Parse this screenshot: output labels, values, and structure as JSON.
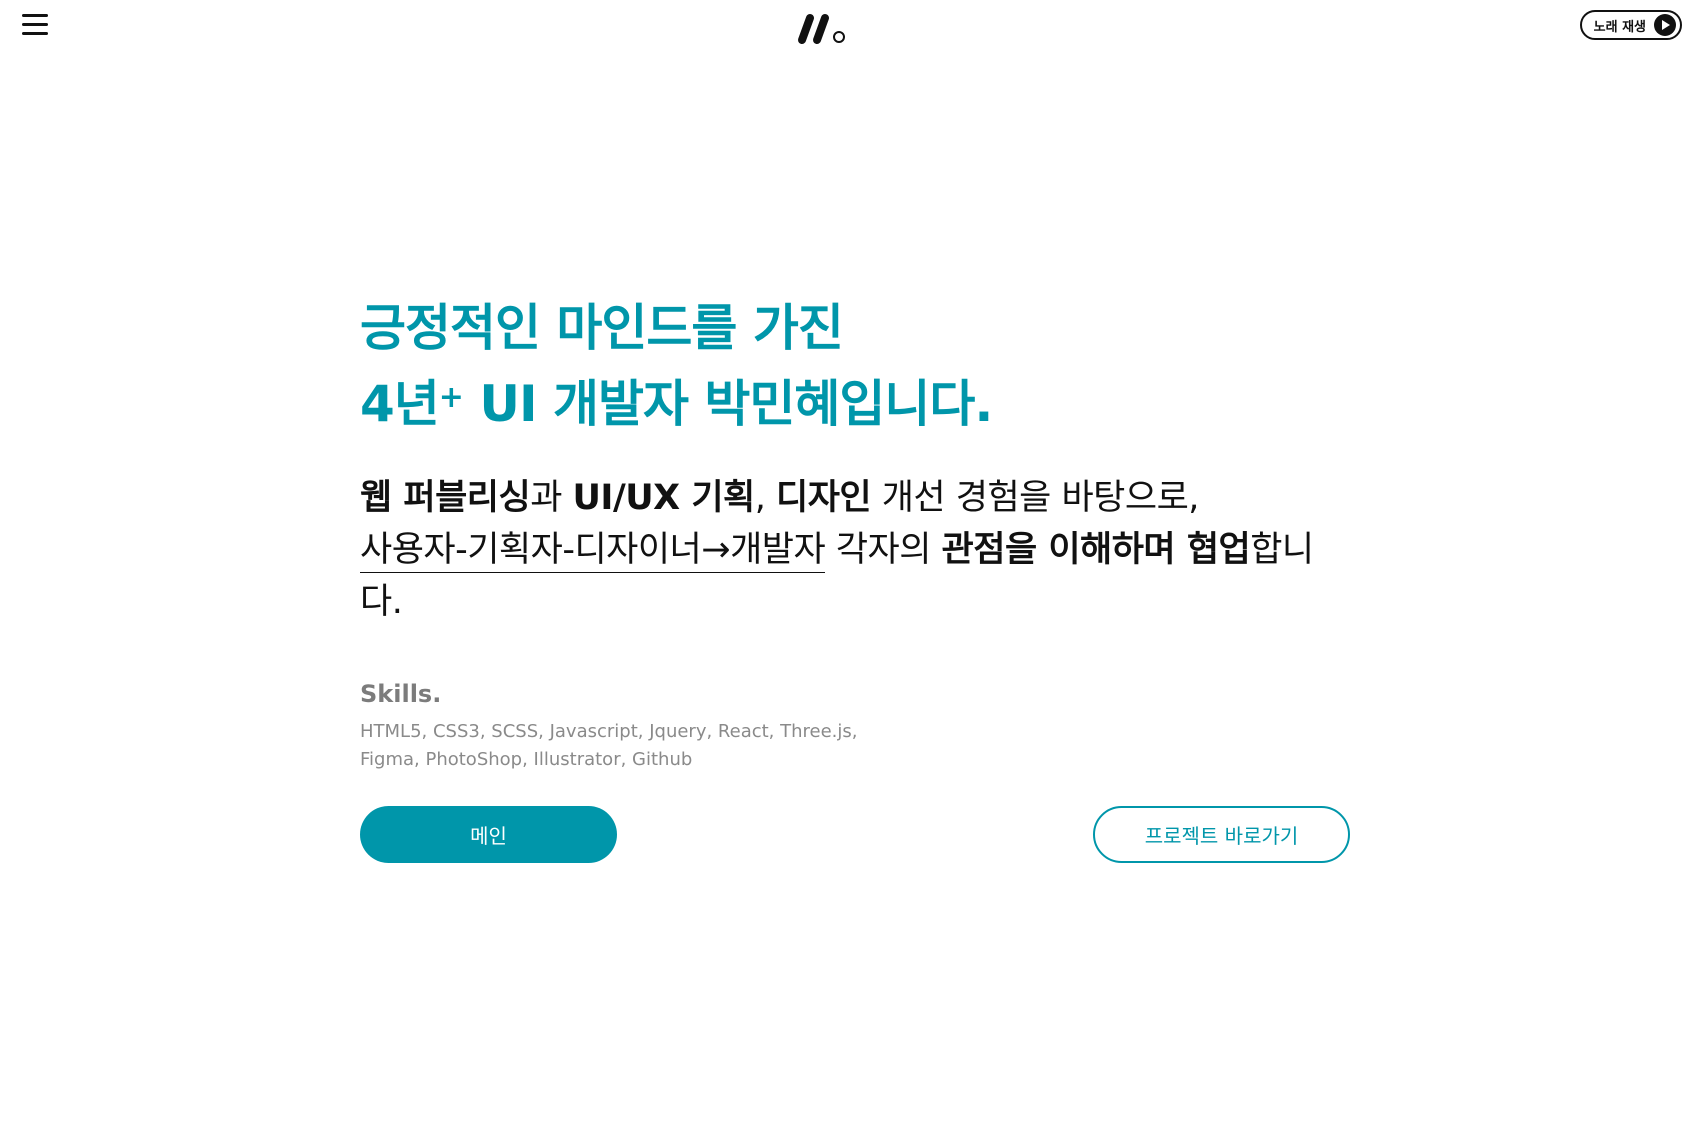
{
  "header": {
    "menu_icon": "hamburger-menu-icon",
    "logo_icon": "brand-logo",
    "music_button_label": "노래 재생",
    "music_icon": "play-circle-icon"
  },
  "hero": {
    "headline_line1": "긍정적인 마인드를 가진",
    "headline_line2_prefix": "4년",
    "headline_line2_sup": "+",
    "headline_line2_rest": " UI 개발자 박민혜입니다.",
    "intro": {
      "s1_bold": "웹 퍼블리싱",
      "s2": "과 ",
      "s3_bold": "UI/UX 기획",
      "s4": ", ",
      "s5_bold": "디자인",
      "s6": " 개선 경험을 바탕으로,",
      "s7_underline": "사용자-기획자-디자이너→개발자",
      "s8": " 각자의 ",
      "s9_bold": "관점을 이해하며 협업",
      "s10": "합니다."
    }
  },
  "skills": {
    "title": "Skills.",
    "line1": "HTML5, CSS3, SCSS, Javascript, Jquery, React, Three.js,",
    "line2": "Figma, PhotoShop, Illustrator, Github"
  },
  "buttons": {
    "main_label": "메인",
    "project_label": "프로젝트 바로가기"
  },
  "colors": {
    "accent": "#0096aa",
    "text": "#111111",
    "muted": "#8a8a8a"
  }
}
